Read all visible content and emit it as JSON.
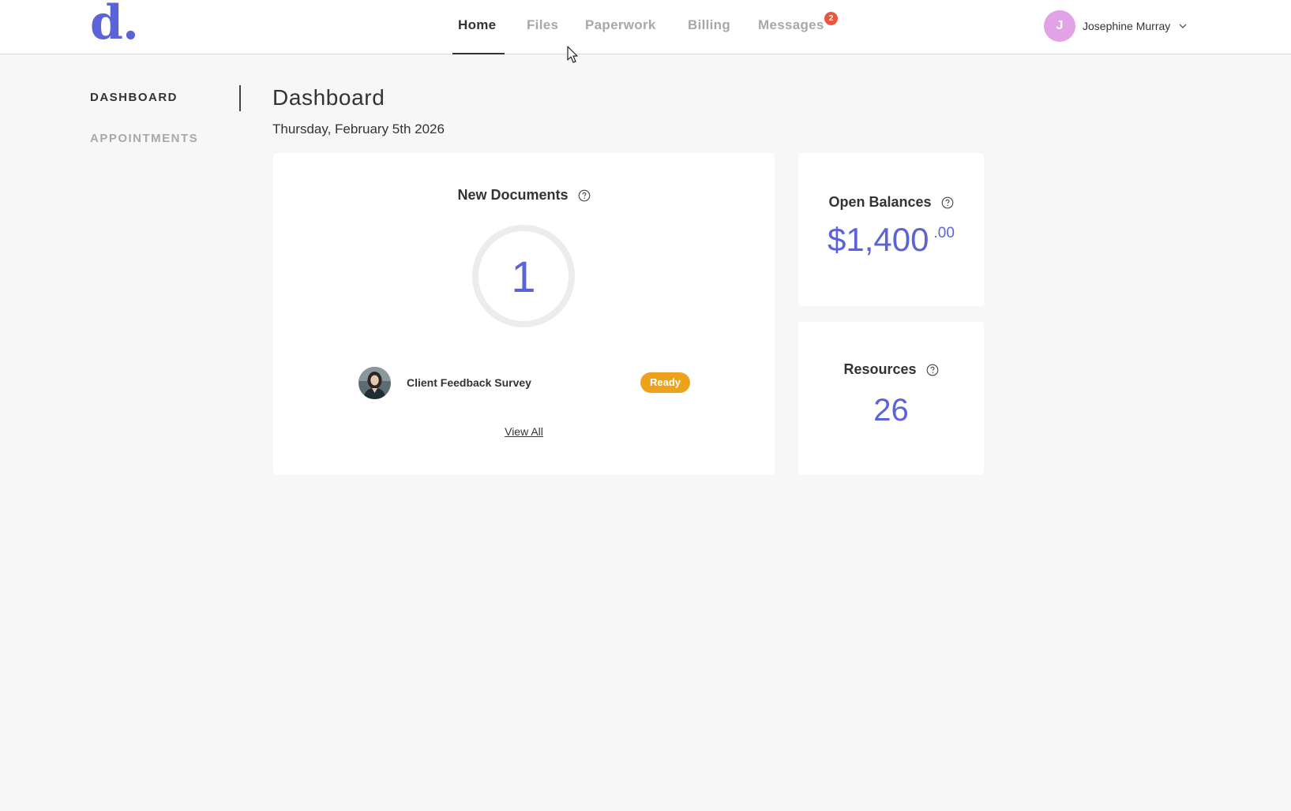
{
  "brand": {
    "logo_text": "d.",
    "accent_color": "#5b63d9"
  },
  "nav": {
    "items": [
      {
        "label": "Home",
        "active": true
      },
      {
        "label": "Files",
        "active": false
      },
      {
        "label": "Paperwork",
        "active": false
      },
      {
        "label": "Billing",
        "active": false
      },
      {
        "label": "Messages",
        "active": false
      }
    ],
    "messages_badge": "2"
  },
  "user": {
    "initial": "J",
    "name": "Josephine Murray",
    "menu_icon": "chevron-down-icon"
  },
  "sidebar": {
    "items": [
      {
        "label": "DASHBOARD",
        "active": true
      },
      {
        "label": "APPOINTMENTS",
        "active": false
      }
    ]
  },
  "page": {
    "title": "Dashboard",
    "date": "Thursday, February 5th 2026"
  },
  "new_documents": {
    "title": "New Documents",
    "count": "1",
    "documents": [
      {
        "name": "Client Feedback Survey",
        "status": "Ready",
        "status_color": "#eea21c"
      }
    ],
    "view_all_label": "View All"
  },
  "open_balances": {
    "title": "Open Balances",
    "amount_main": "$1,400",
    "amount_cents": ".00"
  },
  "resources": {
    "title": "Resources",
    "count": "26"
  }
}
